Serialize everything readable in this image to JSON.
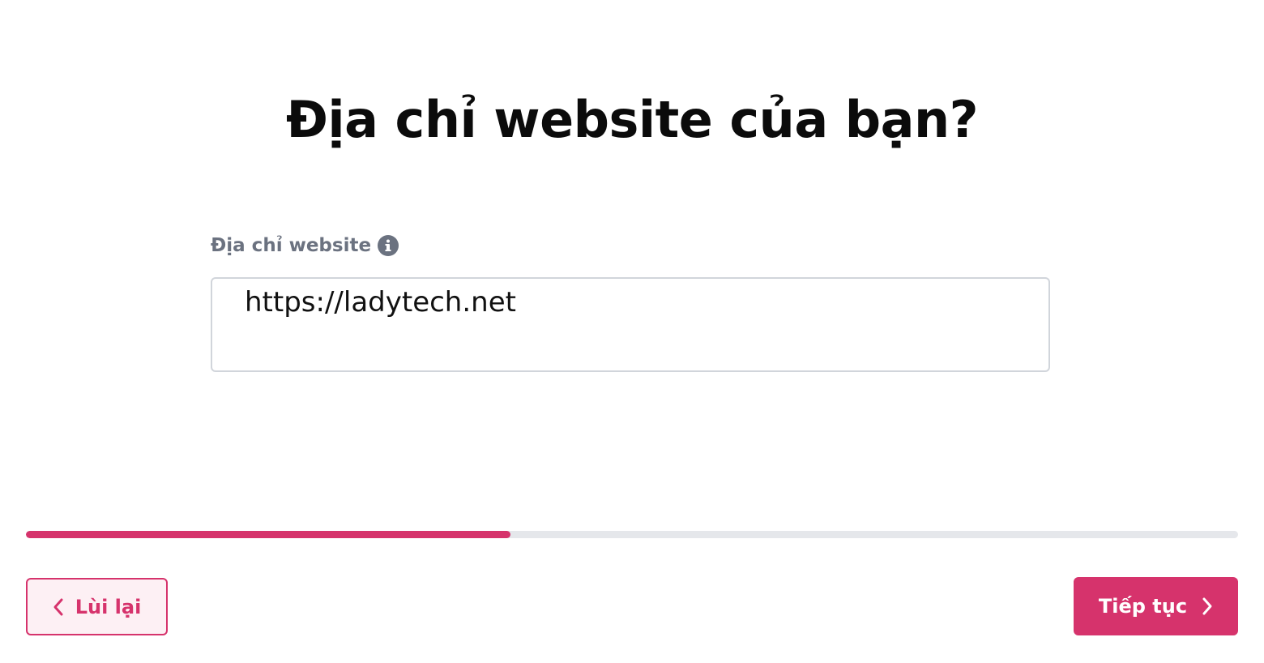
{
  "page": {
    "title": "Địa chỉ website của bạn?"
  },
  "field": {
    "label": "Địa chỉ website",
    "value": "https://ladytech.net",
    "info_icon": "info-circle-icon"
  },
  "progress": {
    "fraction": 0.4
  },
  "nav": {
    "back_label": "Lùi lại",
    "back_icon": "chevron-left-icon",
    "next_label": "Tiếp tục",
    "next_icon": "chevron-right-icon"
  },
  "colors": {
    "accent": "#d6336c",
    "accent_light_bg": "#fdf0f4",
    "track": "#e5e7eb",
    "label_gray": "#6b7280",
    "border_gray": "#d1d5db"
  }
}
